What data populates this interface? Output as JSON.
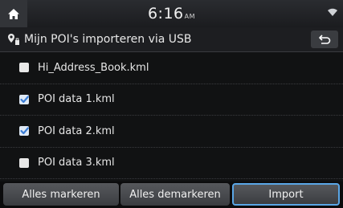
{
  "status": {
    "time": "6:16",
    "ampm": "AM"
  },
  "header": {
    "title": "Mijn POI's importeren via USB"
  },
  "files": [
    {
      "name": "Hi_Address_Book.kml",
      "checked": false
    },
    {
      "name": "POI data 1.kml",
      "checked": true
    },
    {
      "name": "POI data 2.kml",
      "checked": true
    },
    {
      "name": "POI data 3.kml",
      "checked": false
    }
  ],
  "buttons": {
    "mark_all": "Alles markeren",
    "unmark_all": "Alles demarkeren",
    "import": "Import"
  },
  "colors": {
    "accent": "#5aa6e6",
    "check": "#3a7dd6"
  },
  "icons": [
    "home-icon",
    "wifi-icon",
    "poi-usb-icon",
    "back-arrow-icon",
    "check-icon"
  ]
}
